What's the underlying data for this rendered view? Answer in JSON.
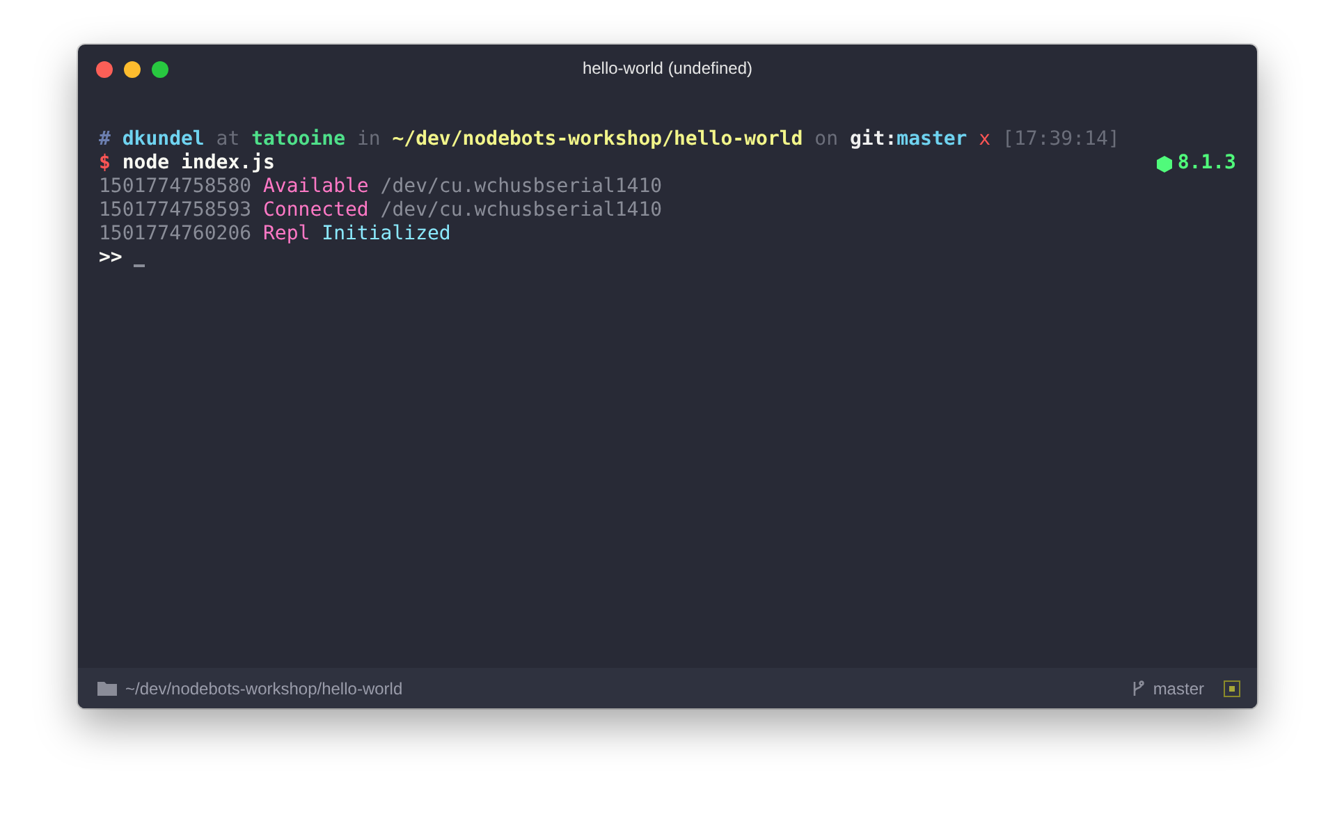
{
  "window": {
    "title": "hello-world (undefined)"
  },
  "terminal": {
    "lines": [
      {
        "segments": [
          {
            "text": "#",
            "color": "#6c7fb0",
            "bold": true
          },
          {
            "text": "dkundel",
            "color": "#6fd3f0",
            "bold": true
          },
          {
            "text": "at",
            "color": "#6b6e7a",
            "bold": false
          },
          {
            "text": "tatooine",
            "color": "#4fe08a",
            "bold": true
          },
          {
            "text": "in",
            "color": "#6b6e7a",
            "bold": false
          },
          {
            "text": "~/dev/nodebots-workshop/hello-world",
            "color": "#f2f58a",
            "bold": true
          },
          {
            "text": "on",
            "color": "#6b6e7a",
            "bold": false
          },
          {
            "text": "git:",
            "color": "#f0f0f0",
            "bold": true
          },
          {
            "text": "master",
            "color": "#6fd3f0",
            "bold": true,
            "joined": true
          },
          {
            "text": "x",
            "color": "#ff5555",
            "bold": false
          },
          {
            "text": "[17:39:14]",
            "color": "#6b6e7a",
            "bold": false
          }
        ]
      },
      {
        "segments": [
          {
            "text": "$",
            "color": "#ff5555",
            "bold": true
          },
          {
            "text": "node index.js",
            "color": "#f8f8f2",
            "bold": true
          }
        ],
        "aside": {
          "text": "8.1.3",
          "color": "#50fa7b"
        }
      },
      {
        "segments": [
          {
            "text": "1501774758580",
            "color": "#8a8d98",
            "bold": false
          },
          {
            "text": "Available",
            "color": "#ff79c6",
            "bold": false
          },
          {
            "text": "/dev/cu.wchusbserial1410",
            "color": "#8a8d98",
            "bold": false
          }
        ]
      },
      {
        "segments": [
          {
            "text": "1501774758593",
            "color": "#8a8d98",
            "bold": false
          },
          {
            "text": "Connected",
            "color": "#ff79c6",
            "bold": false
          },
          {
            "text": "/dev/cu.wchusbserial1410",
            "color": "#8a8d98",
            "bold": false
          }
        ]
      },
      {
        "segments": [
          {
            "text": "1501774760206",
            "color": "#8a8d98",
            "bold": false
          },
          {
            "text": "Repl",
            "color": "#ff79c6",
            "bold": false
          },
          {
            "text": "Initialized",
            "color": "#8be9fd",
            "bold": false
          }
        ]
      },
      {
        "segments": [
          {
            "text": ">>",
            "color": "#f8f8f2",
            "bold": true
          }
        ],
        "cursor": true
      }
    ]
  },
  "status_bar": {
    "path": "~/dev/nodebots-workshop/hello-world",
    "branch": "master"
  }
}
